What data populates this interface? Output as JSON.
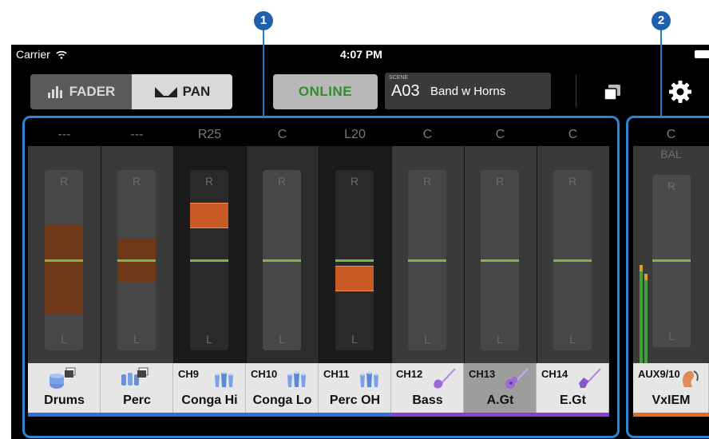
{
  "callouts": [
    "1",
    "2"
  ],
  "status_bar": {
    "carrier": "Carrier",
    "time": "4:07 PM"
  },
  "toolbar": {
    "fader_label": "FADER",
    "pan_label": "PAN",
    "online_label": "ONLINE",
    "scene_caption": "SCENE",
    "scene_number": "A03",
    "scene_name": "Band w Horns"
  },
  "channels": [
    {
      "id": "",
      "name": "Drums",
      "pan": "---",
      "width_top": 0.7,
      "width_bottom": 0.2,
      "cap": null,
      "icon": "drum-kit-icon",
      "color": "#2f6fd6",
      "tone": "light",
      "selected": false
    },
    {
      "id": "",
      "name": "Perc",
      "pan": "---",
      "width_top": 0.62,
      "width_bottom": 0.38,
      "cap": null,
      "icon": "percussion-icon",
      "color": "#2f6fd6",
      "tone": "light",
      "selected": false
    },
    {
      "id": "CH9",
      "name": "Conga Hi",
      "pan": "R25",
      "width_top": null,
      "width_bottom": null,
      "cap": 0.75,
      "icon": "conga-icon",
      "color": "#2f6fd6",
      "tone": "dark",
      "selected": false
    },
    {
      "id": "CH10",
      "name": "Conga Lo",
      "pan": "C",
      "width_top": null,
      "width_bottom": null,
      "cap": null,
      "icon": "conga-icon",
      "color": "#2f6fd6",
      "tone": "mid",
      "selected": false
    },
    {
      "id": "CH11",
      "name": "Perc OH",
      "pan": "L20",
      "width_top": null,
      "width_bottom": null,
      "cap": 0.4,
      "icon": "conga-icon",
      "color": "#2f6fd6",
      "tone": "dark",
      "selected": false
    },
    {
      "id": "CH12",
      "name": "Bass",
      "pan": "C",
      "width_top": null,
      "width_bottom": null,
      "cap": null,
      "icon": "bass-guitar-icon",
      "color": "#8a3fd1",
      "tone": "light",
      "selected": false
    },
    {
      "id": "CH13",
      "name": "A.Gt",
      "pan": "C",
      "width_top": null,
      "width_bottom": null,
      "cap": null,
      "icon": "acoustic-guitar-icon",
      "color": "#8a3fd1",
      "tone": "light",
      "selected": true
    },
    {
      "id": "CH14",
      "name": "E.Gt",
      "pan": "C",
      "width_top": null,
      "width_bottom": null,
      "cap": null,
      "icon": "electric-guitar-icon",
      "color": "#8a3fd1",
      "tone": "light",
      "selected": false
    }
  ],
  "aux": {
    "id": "AUX9/10",
    "name": "VxIEM",
    "pan": "C",
    "balance_label": "BAL",
    "icon": "in-ear-monitor-icon",
    "color": "#e36a1e",
    "meter_left": 0.88,
    "meter_right": 0.8
  },
  "track_labels": {
    "right": "R",
    "left": "L"
  }
}
